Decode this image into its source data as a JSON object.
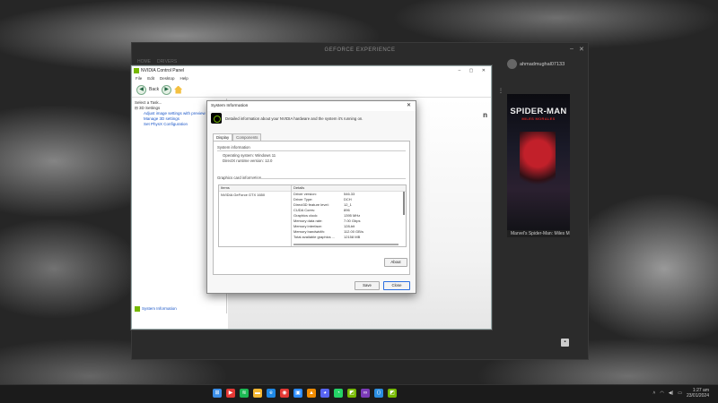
{
  "gfe": {
    "title": "GEFORCE EXPERIENCE",
    "nav": [
      "HOME",
      "DRIVERS"
    ],
    "username": "ahmadmughal07133",
    "game_label": "Marvel's Spider-Man: Miles Morales",
    "logo_title": "SPIDER-MAN",
    "logo_sub": "MILES MORALES"
  },
  "ncp": {
    "title": "NVIDIA Control Panel",
    "menu": [
      "File",
      "Edit",
      "Desktop",
      "Help"
    ],
    "back_label": "Back",
    "task_header": "Select a Task...",
    "tree_root": "3D Settings",
    "tree_items": [
      "Adjust image settings with preview",
      "Manage 3D settings",
      "Set PhysX Configuration"
    ],
    "system_info_link": "System Information",
    "brand": "n"
  },
  "dialog": {
    "title": "System Information",
    "header_text": "Detailed information about your NVIDIA hardware and the system it's running on.",
    "tabs": [
      "Display",
      "Components"
    ],
    "system_section": "System information",
    "os_line": "Operating system:",
    "os_value": "Windows 11",
    "dx_line": "DirectX runtime version:",
    "dx_value": "12.0",
    "graphics_section": "Graphics card information",
    "items_header": "Items",
    "details_header": "Details",
    "item_selected": "NVIDIA GeForce GTX 1650",
    "details": [
      {
        "k": "Driver version:",
        "v": "546.33"
      },
      {
        "k": "Driver Type:",
        "v": "DCH"
      },
      {
        "k": "Direct3D feature level:",
        "v": "12_1"
      },
      {
        "k": "CUDA Cores:",
        "v": "896"
      },
      {
        "k": "Graphics clock:",
        "v": "1395 MHz"
      },
      {
        "k": "Memory data rate:",
        "v": "7.00 Gbps"
      },
      {
        "k": "Memory interface:",
        "v": "128-bit"
      },
      {
        "k": "Memory bandwidth:",
        "v": "112.00 GB/s"
      },
      {
        "k": "Total available graphics ...",
        "v": "12158 MB"
      }
    ],
    "about_label": "About",
    "save_label": "Save",
    "close_label": "Close"
  },
  "taskbar": {
    "icons": [
      "windows-start",
      "youtube",
      "spotify",
      "file-explorer",
      "edge",
      "chrome",
      "zoom",
      "vlc",
      "discord",
      "whatsapp",
      "nvidia",
      "visual-studio",
      "vscode",
      "nvidia-app"
    ],
    "icon_colors": [
      "#3b8ee8",
      "#e53935",
      "#1db954",
      "#f3b632",
      "#1e88e5",
      "#e53935",
      "#2d8cff",
      "#f08b00",
      "#5865f2",
      "#25d366",
      "#76b900",
      "#7b3bb8",
      "#2a8de0",
      "#76b900"
    ],
    "time": "1:27 am",
    "date": "23/01/2024",
    "lang": "ENG"
  }
}
